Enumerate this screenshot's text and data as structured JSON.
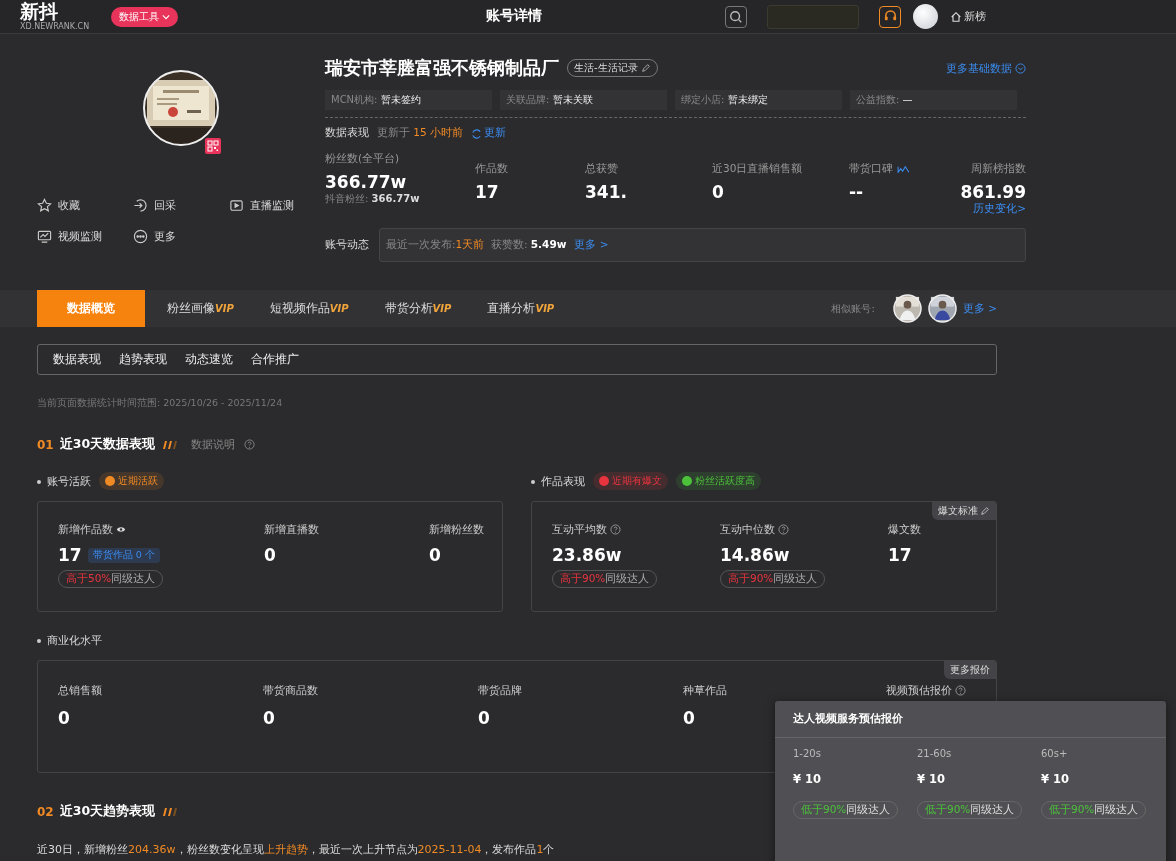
{
  "header": {
    "logo": "新抖",
    "logo_sub": "XD.NEWRANK.CN",
    "tool_button": "数据工具",
    "page_title": "账号详情",
    "rank_link": "新榜"
  },
  "profile": {
    "name": "瑞安市莘塍富强不锈钢制品厂",
    "category": "生活-生活记录",
    "more_link": "更多基础数据",
    "info_fields": [
      {
        "label": "MCN机构:",
        "value": "暂未签约"
      },
      {
        "label": "关联品牌:",
        "value": "暂未关联"
      },
      {
        "label": "绑定小店:",
        "value": "暂未绑定"
      },
      {
        "label": "公益指数:",
        "value": "—"
      }
    ],
    "data_label": "数据表现",
    "updated_prefix": "更新于",
    "updated_time": "15 小时前",
    "refresh": "更新",
    "stats": [
      {
        "label": "粉丝数(全平台)",
        "value": "366.77w",
        "sub_label": "抖音粉丝:",
        "sub_value": "366.77w"
      },
      {
        "label": "作品数",
        "value": "17"
      },
      {
        "label": "总获赞",
        "value": "341."
      },
      {
        "label": "近30日直播销售额",
        "value": "0"
      },
      {
        "label": "带货口碑",
        "value": "--",
        "chart_icon": true
      },
      {
        "label": "周新榜指数",
        "value": "861.99",
        "link": "历史变化>"
      }
    ],
    "activity": {
      "label": "账号动态",
      "publish_label": "最近一次发布:",
      "publish_value": "1天前",
      "likes_label": "获赞数:",
      "likes_value": "5.49w",
      "more": "更多 >"
    },
    "actions": [
      {
        "label": "收藏",
        "kind": "star"
      },
      {
        "label": "回采",
        "kind": "enter"
      },
      {
        "label": "直播监测",
        "kind": "play"
      },
      {
        "label": "视频监测",
        "kind": "monitor"
      },
      {
        "label": "更多",
        "kind": "more"
      }
    ]
  },
  "tabs": [
    {
      "label": "数据概览",
      "selected": true
    },
    {
      "label": "粉丝画像",
      "badge": "VIP",
      "selected": false
    },
    {
      "label": "短视频作品",
      "badge": "VIP",
      "selected": false
    },
    {
      "label": "带货分析",
      "badge": "VIP",
      "selected": false
    },
    {
      "label": "直播分析",
      "badge": "VIP",
      "selected": false
    }
  ],
  "similar": {
    "label": "相似账号:",
    "more": "更多 >"
  },
  "subtabs": [
    "数据表现",
    "趋势表现",
    "动态速览",
    "合作推广"
  ],
  "date_range": "当前页面数据统计时间范围: 2025/10/26 - 2025/11/24",
  "section1": {
    "number": "01",
    "title": "近30天数据表现",
    "help": "数据说明"
  },
  "groups": [
    {
      "title": "账号活跃",
      "tags": [
        {
          "label": "近期活跃",
          "color": "#f08a24"
        }
      ],
      "metrics": [
        {
          "label": "新增作品数",
          "eye": true,
          "help": false,
          "value": "17",
          "chip": "带货作品 0 个",
          "compare": {
            "highlight": "高于50%",
            "text": "同级达人",
            "higher": true
          }
        },
        {
          "label": "新增直播数",
          "eye": false,
          "help": false,
          "value": "0"
        },
        {
          "label": "新增粉丝数",
          "eye": false,
          "help": false,
          "value": "0"
        }
      ]
    },
    {
      "title": "作品表现",
      "tags": [
        {
          "label": "近期有爆文",
          "color": "#e8343f"
        },
        {
          "label": "粉丝活跃度高",
          "color": "#4cc13a"
        }
      ],
      "corner": "爆文标准",
      "metrics": [
        {
          "label": "互动平均数",
          "eye": false,
          "help": true,
          "value": "23.86w",
          "compare": {
            "highlight": "高于90%",
            "text": "同级达人",
            "higher": true
          }
        },
        {
          "label": "互动中位数",
          "eye": false,
          "help": true,
          "value": "14.86w",
          "compare": {
            "highlight": "高于90%",
            "text": "同级达人",
            "higher": true
          }
        },
        {
          "label": "爆文数",
          "eye": false,
          "help": false,
          "value": "17"
        }
      ]
    }
  ],
  "commerce": {
    "title": "商业化水平",
    "corner": "更多报价",
    "metrics": [
      {
        "label": "总销售额",
        "help": false,
        "value": "0"
      },
      {
        "label": "带货商品数",
        "help": false,
        "value": "0"
      },
      {
        "label": "带货品牌",
        "help": false,
        "value": "0"
      },
      {
        "label": "种草作品",
        "help": false,
        "value": "0"
      },
      {
        "label": "视频预估报价",
        "help": true
      }
    ]
  },
  "tooltip": {
    "title": "达人视频服务预估报价",
    "columns": [
      {
        "label": "1-20s",
        "price": "¥ 10",
        "compare": {
          "highlight": "低于90%",
          "text": "同级达人",
          "higher": false
        }
      },
      {
        "label": "21-60s",
        "price": "¥ 10",
        "compare": {
          "highlight": "低于90%",
          "text": "同级达人",
          "higher": false
        }
      },
      {
        "label": "60s+",
        "price": "¥ 10",
        "compare": {
          "highlight": "低于90%",
          "text": "同级达人",
          "higher": false
        }
      }
    ]
  },
  "section2": {
    "number": "02",
    "title": "近30天趋势表现",
    "summary": [
      {
        "text": "近30日，新增粉丝",
        "highlight": false
      },
      {
        "text": "204.36w",
        "highlight": true
      },
      {
        "text": "，粉丝数变化呈现",
        "highlight": false
      },
      {
        "text": "上升趋势",
        "highlight": true
      },
      {
        "text": "，最近一次上升节点为",
        "highlight": false
      },
      {
        "text": "2025-11-04",
        "highlight": true
      },
      {
        "text": "，发布作品",
        "highlight": false
      },
      {
        "text": "1",
        "highlight": true
      },
      {
        "text": "个",
        "highlight": false
      }
    ]
  }
}
